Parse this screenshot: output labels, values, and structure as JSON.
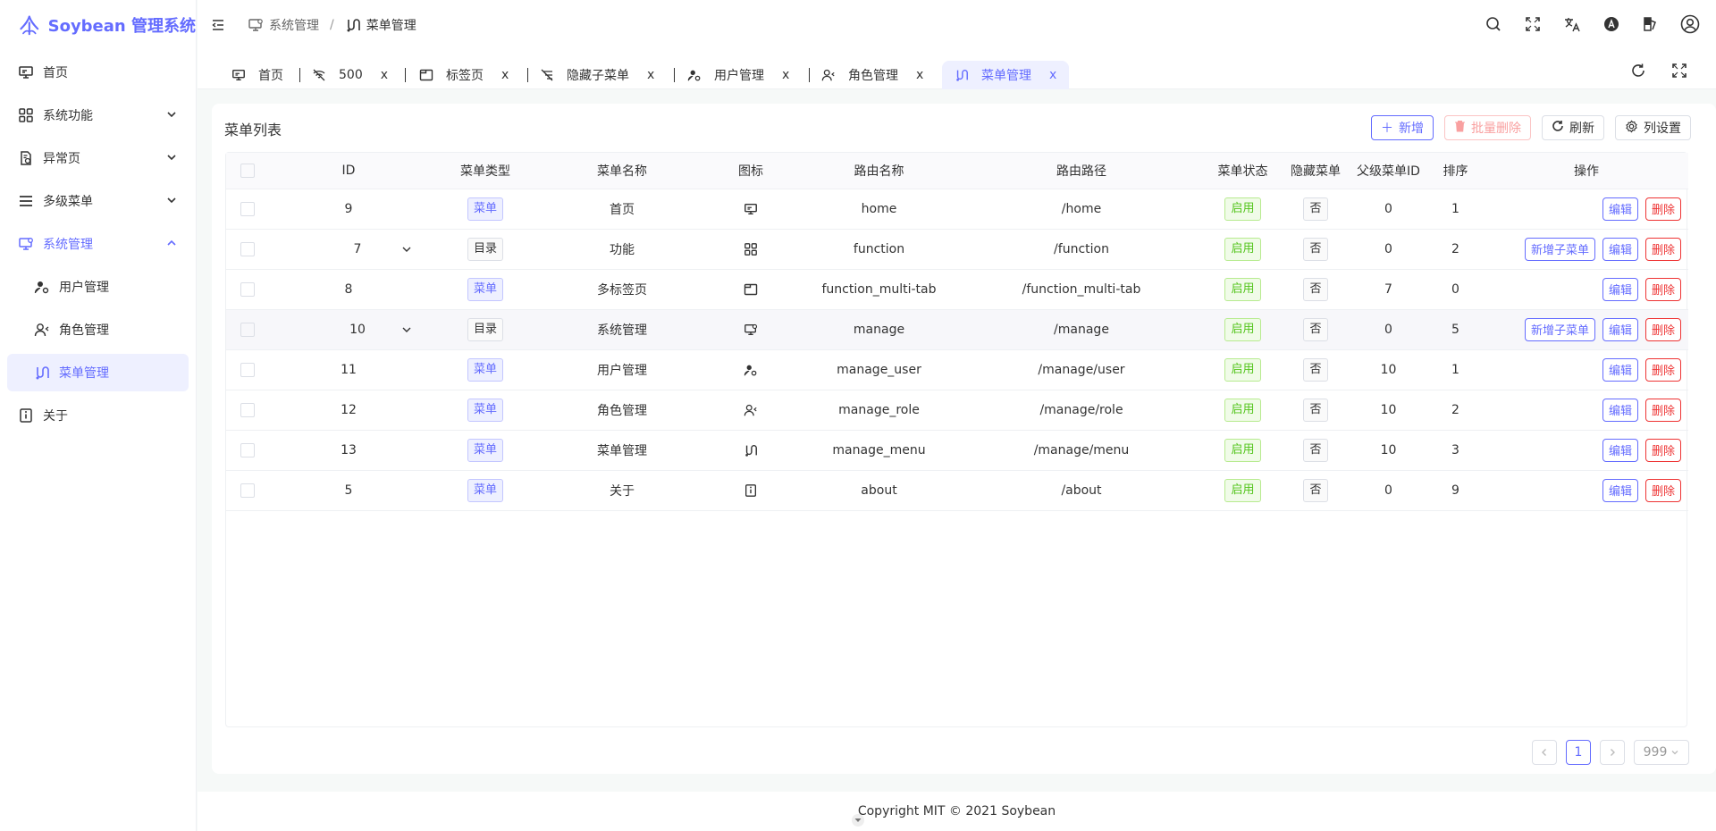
{
  "app": {
    "title": "Soybean 管理系统",
    "accent": "#646cff"
  },
  "sidebar": {
    "items": [
      {
        "label": "首页",
        "icon": "monitor-icon"
      },
      {
        "label": "系统功能",
        "icon": "grid-icon"
      },
      {
        "label": "异常页",
        "icon": "error-page-icon"
      },
      {
        "label": "多级菜单",
        "icon": "list-icon"
      },
      {
        "label": "系统管理",
        "icon": "monitor-settings-icon"
      },
      {
        "label": "用户管理",
        "icon": "user-settings-icon"
      },
      {
        "label": "角色管理",
        "icon": "user-role-icon"
      },
      {
        "label": "菜单管理",
        "icon": "route-icon"
      },
      {
        "label": "关于",
        "icon": "info-icon"
      }
    ]
  },
  "breadcrumb": {
    "parent": "系统管理",
    "current": "菜单管理"
  },
  "tabs": [
    {
      "label": "首页",
      "icon": "monitor-icon",
      "closable": false
    },
    {
      "label": "500",
      "icon": "wifi-off-icon",
      "closable": true
    },
    {
      "label": "标签页",
      "icon": "tab-window-icon",
      "closable": true
    },
    {
      "label": "隐藏子菜单",
      "icon": "hidden-menu-icon",
      "closable": true
    },
    {
      "label": "用户管理",
      "icon": "user-settings-icon",
      "closable": true
    },
    {
      "label": "角色管理",
      "icon": "user-role-icon",
      "closable": true
    },
    {
      "label": "菜单管理",
      "icon": "route-icon",
      "closable": true
    }
  ],
  "close_glyph": "x",
  "card": {
    "title": "菜单列表",
    "actions": {
      "add": "新增",
      "batch_delete": "批量删除",
      "refresh": "刷新",
      "columns": "列设置"
    }
  },
  "table": {
    "columns": [
      "ID",
      "菜单类型",
      "菜单名称",
      "图标",
      "路由名称",
      "路由路径",
      "菜单状态",
      "隐藏菜单",
      "父级菜单ID",
      "排序",
      "操作"
    ],
    "rows": [
      {
        "id": "9",
        "type": "菜单",
        "name": "首页",
        "icon": "monitor-icon",
        "route_name": "home",
        "route_path": "/home",
        "status": "启用",
        "hidden": "否",
        "parent_id": "0",
        "order": "1",
        "expandable": false,
        "add_sub": false
      },
      {
        "id": "7",
        "type": "目录",
        "name": "功能",
        "icon": "grid-icon",
        "route_name": "function",
        "route_path": "/function",
        "status": "启用",
        "hidden": "否",
        "parent_id": "0",
        "order": "2",
        "expandable": true,
        "add_sub": true
      },
      {
        "id": "8",
        "type": "菜单",
        "name": "多标签页",
        "icon": "tab-window-icon",
        "route_name": "function_multi-tab",
        "route_path": "/function_multi-tab",
        "status": "启用",
        "hidden": "否",
        "parent_id": "7",
        "order": "0",
        "expandable": false,
        "add_sub": false
      },
      {
        "id": "10",
        "type": "目录",
        "name": "系统管理",
        "icon": "monitor-settings-icon",
        "route_name": "manage",
        "route_path": "/manage",
        "status": "启用",
        "hidden": "否",
        "parent_id": "0",
        "order": "5",
        "expandable": true,
        "add_sub": true
      },
      {
        "id": "11",
        "type": "菜单",
        "name": "用户管理",
        "icon": "user-settings-icon",
        "route_name": "manage_user",
        "route_path": "/manage/user",
        "status": "启用",
        "hidden": "否",
        "parent_id": "10",
        "order": "1",
        "expandable": false,
        "add_sub": false
      },
      {
        "id": "12",
        "type": "菜单",
        "name": "角色管理",
        "icon": "user-role-icon",
        "route_name": "manage_role",
        "route_path": "/manage/role",
        "status": "启用",
        "hidden": "否",
        "parent_id": "10",
        "order": "2",
        "expandable": false,
        "add_sub": false
      },
      {
        "id": "13",
        "type": "菜单",
        "name": "菜单管理",
        "icon": "route-icon",
        "route_name": "manage_menu",
        "route_path": "/manage/menu",
        "status": "启用",
        "hidden": "否",
        "parent_id": "10",
        "order": "3",
        "expandable": false,
        "add_sub": false
      },
      {
        "id": "5",
        "type": "菜单",
        "name": "关于",
        "icon": "info-icon",
        "route_name": "about",
        "route_path": "/about",
        "status": "启用",
        "hidden": "否",
        "parent_id": "0",
        "order": "9",
        "expandable": false,
        "add_sub": false
      }
    ],
    "ops": {
      "add_sub": "新增子菜单",
      "edit": "编辑",
      "delete": "删除"
    }
  },
  "pagination": {
    "current": "1",
    "page_size": "999"
  },
  "footer": {
    "text": "Copyright MIT © 2021 Soybean"
  }
}
